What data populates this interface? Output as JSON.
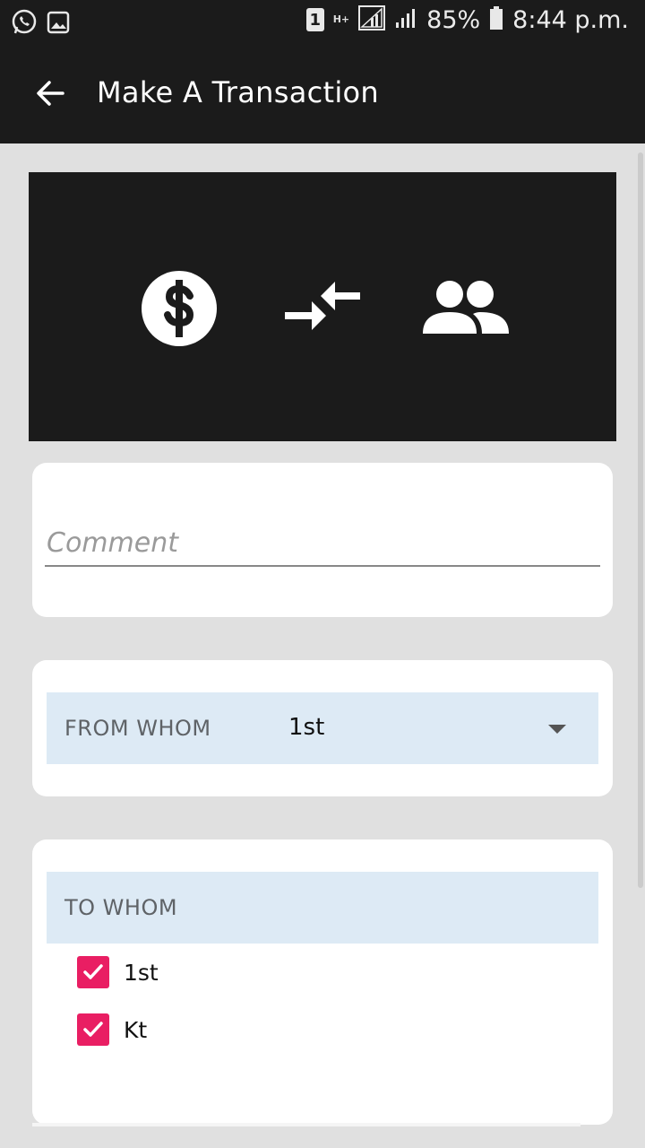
{
  "status_bar": {
    "battery_percent": "85%",
    "time": "8:44 p.m.",
    "sim_slot": "1",
    "network_type": "H+",
    "icons": [
      "whatsapp-icon",
      "gallery-icon",
      "sim-icon",
      "signal-icon",
      "battery-icon"
    ]
  },
  "app_bar": {
    "title": "Make A Transaction",
    "back_icon": "arrow-back-icon"
  },
  "hero": {
    "icons": [
      "dollar-circle-icon",
      "transfer-arrows-icon",
      "people-icon"
    ]
  },
  "comment": {
    "placeholder": "Comment",
    "value": ""
  },
  "from_whom": {
    "label": "FROM WHOM",
    "selected": "1st"
  },
  "to_whom": {
    "label": "TO WHOM",
    "options": [
      {
        "label": "1st",
        "checked": true
      },
      {
        "label": "Kt",
        "checked": true
      }
    ]
  },
  "colors": {
    "bar_background": "#1b1b1b",
    "page_background": "#e0e0e0",
    "spinner_background": "#ddeaf5",
    "checkbox_accent": "#e91e63"
  }
}
